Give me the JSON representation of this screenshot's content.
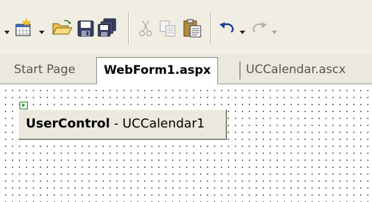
{
  "tabs": [
    {
      "label": "Start Page",
      "active": false
    },
    {
      "label": "WebForm1.aspx",
      "active": true
    },
    {
      "label": "UCCalendar.ascx",
      "active": false
    }
  ],
  "toolbar": {
    "icons": [
      "dropdown-arrow-icon",
      "new-project-icon",
      "dropdown-arrow-icon",
      "open-file-icon",
      "save-icon",
      "save-all-icon",
      "cut-icon",
      "copy-icon",
      "paste-icon",
      "undo-icon",
      "dropdown-arrow-icon",
      "redo-icon",
      "dropdown-arrow-icon"
    ]
  },
  "designer": {
    "control_type": "UserControl",
    "control_separator": " - ",
    "control_name": "UCCalendar1"
  },
  "colors": {
    "toolbar_bg": "#f0ede3",
    "tabstrip_bg": "#ebe8dd",
    "control_bg": "#ebe8dd",
    "grid_dot": "#5a5a5a"
  }
}
